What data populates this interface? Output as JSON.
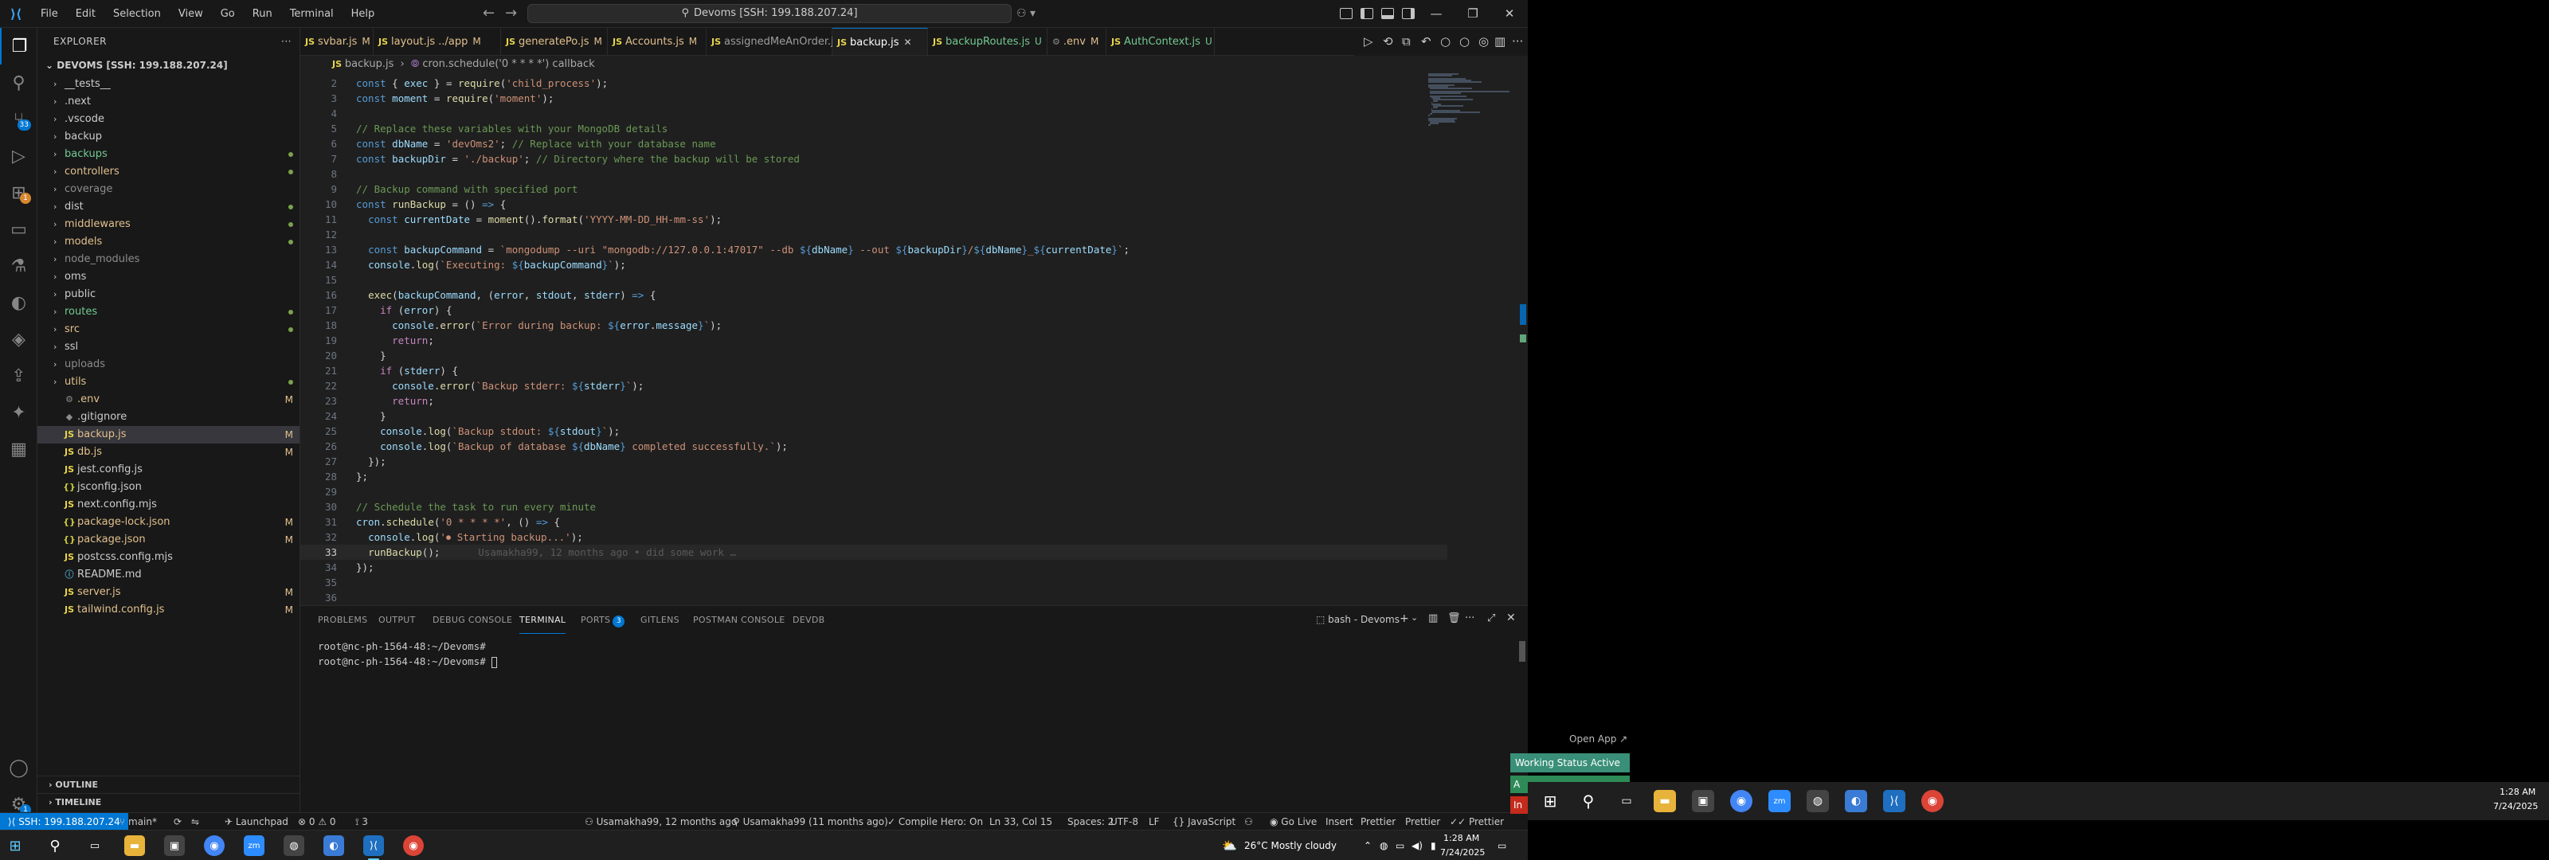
{
  "titlebar": {
    "menu": [
      "File",
      "Edit",
      "Selection",
      "View",
      "Go",
      "Run",
      "Terminal",
      "Help"
    ],
    "command_center": "Devoms [SSH: 199.188.207.24]"
  },
  "sidebar": {
    "header": "EXPLORER",
    "root": "DEVOMS [SSH: 199.188.207.24]",
    "items": [
      {
        "label": "__tests__",
        "type": "folder",
        "status": ""
      },
      {
        "label": ".next",
        "type": "folder",
        "status": ""
      },
      {
        "label": ".vscode",
        "type": "folder",
        "status": ""
      },
      {
        "label": "backup",
        "type": "folder",
        "status": ""
      },
      {
        "label": "backups",
        "type": "folder",
        "status": "dot",
        "color": "green"
      },
      {
        "label": "controllers",
        "type": "folder",
        "status": "dot",
        "color": "gold"
      },
      {
        "label": "coverage",
        "type": "folder",
        "status": "",
        "color": "gray"
      },
      {
        "label": "dist",
        "type": "folder",
        "status": "dot"
      },
      {
        "label": "middlewares",
        "type": "folder",
        "status": "dot",
        "color": "gold"
      },
      {
        "label": "models",
        "type": "folder",
        "status": "dot",
        "color": "gold"
      },
      {
        "label": "node_modules",
        "type": "folder",
        "status": "",
        "color": "gray"
      },
      {
        "label": "oms",
        "type": "folder",
        "status": ""
      },
      {
        "label": "public",
        "type": "folder",
        "status": ""
      },
      {
        "label": "routes",
        "type": "folder",
        "status": "dot",
        "color": "green"
      },
      {
        "label": "src",
        "type": "folder",
        "status": "dot",
        "color": "gold"
      },
      {
        "label": "ssl",
        "type": "folder",
        "status": ""
      },
      {
        "label": "uploads",
        "type": "folder",
        "status": "",
        "color": "gray"
      },
      {
        "label": "utils",
        "type": "folder",
        "status": "dot",
        "color": "gold"
      },
      {
        "label": ".env",
        "type": "file",
        "icon": "⚙",
        "status": "M",
        "color": "gold"
      },
      {
        "label": ".gitignore",
        "type": "file",
        "icon": "◆",
        "status": ""
      },
      {
        "label": "backup.js",
        "type": "file",
        "icon": "JS",
        "status": "M",
        "color": "gold",
        "selected": true
      },
      {
        "label": "db.js",
        "type": "file",
        "icon": "JS",
        "status": "M",
        "color": "gold"
      },
      {
        "label": "jest.config.js",
        "type": "file",
        "icon": "JS",
        "status": ""
      },
      {
        "label": "jsconfig.json",
        "type": "file",
        "icon": "{}",
        "status": ""
      },
      {
        "label": "next.config.mjs",
        "type": "file",
        "icon": "JS",
        "status": ""
      },
      {
        "label": "package-lock.json",
        "type": "file",
        "icon": "{}",
        "status": "M",
        "color": "gold"
      },
      {
        "label": "package.json",
        "type": "file",
        "icon": "{}",
        "status": "M",
        "color": "gold"
      },
      {
        "label": "postcss.config.mjs",
        "type": "file",
        "icon": "JS",
        "status": ""
      },
      {
        "label": "README.md",
        "type": "file",
        "icon": "ⓘ",
        "status": ""
      },
      {
        "label": "server.js",
        "type": "file",
        "icon": "JS",
        "status": "M",
        "color": "gold"
      },
      {
        "label": "tailwind.config.js",
        "type": "file",
        "icon": "JS",
        "status": "M",
        "color": "gold"
      }
    ],
    "outline": "OUTLINE",
    "timeline": "TIMELINE"
  },
  "tabs": [
    {
      "label": "svbar.js",
      "mark": "M",
      "icon": "JS"
    },
    {
      "label": "layout.js ../app",
      "mark": "M",
      "icon": "JS"
    },
    {
      "label": "generatePo.js",
      "mark": "M",
      "icon": "JS"
    },
    {
      "label": "Accounts.js",
      "mark": "M",
      "icon": "JS"
    },
    {
      "label": "assignedMeAnOrder.js",
      "mark": "",
      "icon": "JS"
    },
    {
      "label": "backup.js",
      "mark": "✕",
      "icon": "JS",
      "active": true
    },
    {
      "label": "backupRoutes.js",
      "mark": "U",
      "icon": "JS"
    },
    {
      "label": ".env",
      "mark": "M",
      "icon": "⚙"
    },
    {
      "label": "AuthContext.js",
      "mark": "U",
      "icon": "JS"
    }
  ],
  "breadcrumb": {
    "file": "backup.js",
    "sep": "›",
    "symbol": "cron.schedule('0 * * * *') callback"
  },
  "editor": {
    "current_line": 33,
    "blame": "Usamakha99, 12 months ago • did some work …",
    "lines": [
      {
        "n": "2",
        "html": "<span class='k'>const</span> <span class='p'>{</span> <span class='v'>exec</span> <span class='p'>}</span> <span class='p'>=</span> <span class='f'>require</span><span class='p'>(</span><span class='s'>'child_process'</span><span class='p'>);</span>"
      },
      {
        "n": "3",
        "html": "<span class='k'>const</span> <span class='v'>moment</span> <span class='p'>=</span> <span class='f'>require</span><span class='p'>(</span><span class='s'>'moment'</span><span class='p'>);</span>"
      },
      {
        "n": "4",
        "html": ""
      },
      {
        "n": "5",
        "html": "<span class='c'>// Replace these variables with your MongoDB details</span>"
      },
      {
        "n": "6",
        "html": "<span class='k'>const</span> <span class='v'>dbName</span> <span class='p'>=</span> <span class='s'>'devOms2'</span><span class='p'>;</span> <span class='c'>// Replace with your database name</span>"
      },
      {
        "n": "7",
        "html": "<span class='k'>const</span> <span class='v'>backupDir</span> <span class='p'>=</span> <span class='s'>'./backup'</span><span class='p'>;</span> <span class='c'>// Directory where the backup will be stored</span>"
      },
      {
        "n": "8",
        "html": ""
      },
      {
        "n": "9",
        "html": "<span class='c'>// Backup command with specified port</span>"
      },
      {
        "n": "10",
        "html": "<span class='k'>const</span> <span class='f'>runBackup</span> <span class='p'>=</span> <span class='p'>()</span> <span class='k'>=&gt;</span> <span class='p'>{</span>"
      },
      {
        "n": "11",
        "html": "  <span class='k'>const</span> <span class='v'>currentDate</span> <span class='p'>=</span> <span class='f'>moment</span><span class='p'>().</span><span class='f'>format</span><span class='p'>(</span><span class='s'>'YYYY-MM-DD_HH-mm-ss'</span><span class='p'>);</span>"
      },
      {
        "n": "12",
        "html": ""
      },
      {
        "n": "13",
        "html": "  <span class='k'>const</span> <span class='v'>backupCommand</span> <span class='p'>=</span> <span class='s'>`mongodump --uri \"mongodb://127.0.0.1:47017\" --db </span><span class='k'>${</span><span class='v'>dbName</span><span class='k'>}</span><span class='s'> --out </span><span class='k'>${</span><span class='v'>backupDir</span><span class='k'>}</span><span class='s'>/</span><span class='k'>${</span><span class='v'>dbName</span><span class='k'>}</span><span class='s'>_</span><span class='k'>${</span><span class='v'>currentDate</span><span class='k'>}</span><span class='s'>`</span><span class='p'>;</span>"
      },
      {
        "n": "14",
        "html": "  <span class='v'>console</span><span class='p'>.</span><span class='f'>log</span><span class='p'>(</span><span class='s'>`Executing: </span><span class='k'>${</span><span class='v'>backupCommand</span><span class='k'>}</span><span class='s'>`</span><span class='p'>);</span>"
      },
      {
        "n": "15",
        "html": ""
      },
      {
        "n": "16",
        "html": "  <span class='f'>exec</span><span class='p'>(</span><span class='v'>backupCommand</span><span class='p'>,</span> <span class='p'>(</span><span class='v'>error</span><span class='p'>,</span> <span class='v'>stdout</span><span class='p'>,</span> <span class='v'>stderr</span><span class='p'>)</span> <span class='k'>=&gt;</span> <span class='p'>{</span>"
      },
      {
        "n": "17",
        "html": "    <span class='kc'>if</span> <span class='p'>(</span><span class='v'>error</span><span class='p'>)</span> <span class='p'>{</span>"
      },
      {
        "n": "18",
        "html": "      <span class='v'>console</span><span class='p'>.</span><span class='f'>error</span><span class='p'>(</span><span class='s'>`Error during backup: </span><span class='k'>${</span><span class='v'>error</span><span class='p'>.</span><span class='v'>message</span><span class='k'>}</span><span class='s'>`</span><span class='p'>);</span>"
      },
      {
        "n": "19",
        "html": "      <span class='kc'>return</span><span class='p'>;</span>"
      },
      {
        "n": "20",
        "html": "    <span class='p'>}</span>"
      },
      {
        "n": "21",
        "html": "    <span class='kc'>if</span> <span class='p'>(</span><span class='v'>stderr</span><span class='p'>)</span> <span class='p'>{</span>"
      },
      {
        "n": "22",
        "html": "      <span class='v'>console</span><span class='p'>.</span><span class='f'>error</span><span class='p'>(</span><span class='s'>`Backup stderr: </span><span class='k'>${</span><span class='v'>stderr</span><span class='k'>}</span><span class='s'>`</span><span class='p'>);</span>"
      },
      {
        "n": "23",
        "html": "      <span class='kc'>return</span><span class='p'>;</span>"
      },
      {
        "n": "24",
        "html": "    <span class='p'>}</span>"
      },
      {
        "n": "25",
        "html": "    <span class='v'>console</span><span class='p'>.</span><span class='f'>log</span><span class='p'>(</span><span class='s'>`Backup stdout: </span><span class='k'>${</span><span class='v'>stdout</span><span class='k'>}</span><span class='s'>`</span><span class='p'>);</span>"
      },
      {
        "n": "26",
        "html": "    <span class='v'>console</span><span class='p'>.</span><span class='f'>log</span><span class='p'>(</span><span class='s'>`Backup of database </span><span class='k'>${</span><span class='v'>dbName</span><span class='k'>}</span><span class='s'> completed successfully.`</span><span class='p'>);</span>"
      },
      {
        "n": "27",
        "html": "  <span class='p'>});</span>"
      },
      {
        "n": "28",
        "html": "<span class='p'>};</span>"
      },
      {
        "n": "29",
        "html": ""
      },
      {
        "n": "30",
        "html": "<span class='c'>// Schedule the task to run every minute</span>"
      },
      {
        "n": "31",
        "html": "<span class='v'>cron</span><span class='p'>.</span><span class='f'>schedule</span><span class='p'>(</span><span class='s'>'0 * * * *'</span><span class='p'>,</span> <span class='p'>()</span> <span class='k'>=&gt;</span> <span class='p'>{</span>"
      },
      {
        "n": "32",
        "html": "  <span class='v'>console</span><span class='p'>.</span><span class='f'>log</span><span class='p'>(</span><span class='s'>'⏺ Starting backup...'</span><span class='p'>);</span>"
      },
      {
        "n": "33",
        "html": "  <span class='f'>runBackup</span><span class='p'>();</span>"
      },
      {
        "n": "34",
        "html": "<span class='p'>});</span>"
      },
      {
        "n": "35",
        "html": ""
      },
      {
        "n": "36",
        "html": ""
      }
    ]
  },
  "panel": {
    "tabs": [
      {
        "label": "PROBLEMS"
      },
      {
        "label": "OUTPUT"
      },
      {
        "label": "DEBUG CONSOLE"
      },
      {
        "label": "TERMINAL",
        "active": true
      },
      {
        "label": "PORTS",
        "badge": "3"
      },
      {
        "label": "GITLENS"
      },
      {
        "label": "POSTMAN CONSOLE"
      },
      {
        "label": "DEVDB"
      }
    ],
    "terminal_name": "bash - Devoms",
    "terminal_lines": [
      "root@nc-ph-1564-48:~/Devoms#",
      "root@nc-ph-1564-48:~/Devoms#"
    ]
  },
  "statusbar": {
    "remote": "SSH: 199.188.207.24",
    "branch": "main*",
    "launchpad": "Launchpad",
    "problems": "⊗ 0 ⚠ 0",
    "ports": "3",
    "blame": "Usamakha99, 12 months ago",
    "author": "Usamakha99 (11 months ago)",
    "compile_hero": "Compile Hero: On",
    "position": "Ln 33, Col 15",
    "spaces": "Spaces: 2",
    "encoding": "UTF-8",
    "eol": "LF",
    "language": "JavaScript",
    "golive": "Go Live",
    "insert": "Insert",
    "prettier1": "Prettier",
    "prettier2": "Prettier",
    "prettier3": "Prettier"
  },
  "taskbar1": {
    "weather": "26°C  Mostly cloudy",
    "time": "1:28 AM",
    "date": "7/24/2025"
  },
  "taskbar2": {
    "time": "1:28 AM",
    "date": "7/24/2025"
  },
  "notifications": {
    "open_app": "Open App ↗",
    "working_status": "Working Status Active",
    "a_label": "A",
    "i_label": "In"
  },
  "colors": {
    "accent": "#0078d4",
    "modified": "#e2c08d",
    "untracked": "#73c991",
    "status_green": "#2e8b57",
    "status_red": "#c42b1c"
  }
}
